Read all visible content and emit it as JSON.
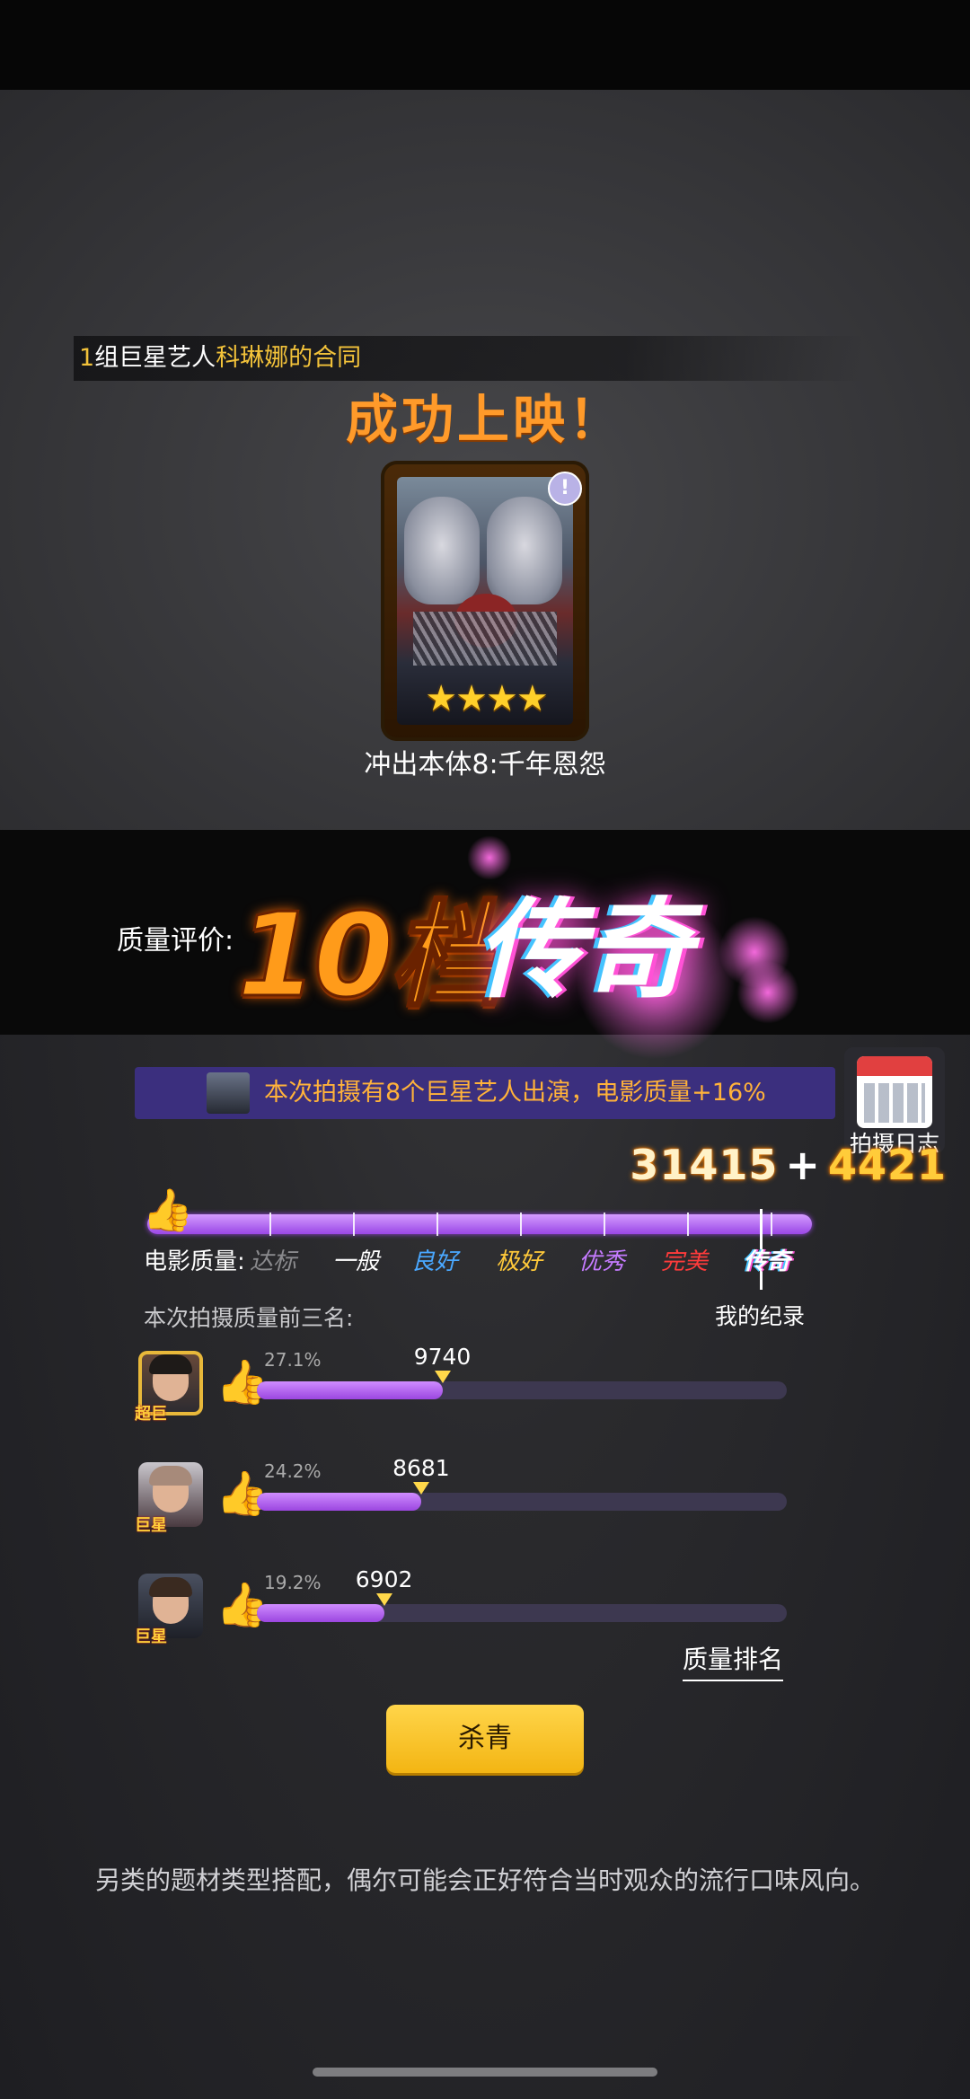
{
  "contract": {
    "count": "1",
    "text1": "组巨星艺人",
    "name": "科琳娜的合同"
  },
  "release_title": "成功上映！",
  "poster": {
    "alert": "!",
    "stars": "★★★★"
  },
  "movie_name": "冲出本体8:千年恩怨",
  "rating": {
    "label": "质量评价:",
    "level": "10档",
    "grade": "传奇"
  },
  "bonus": {
    "text": "本次拍摄有8个巨星艺人出演，电影质量+16%"
  },
  "calendar": {
    "label": "拍摄日志"
  },
  "score": {
    "base": "31415",
    "plus": "+",
    "bonus": "4421"
  },
  "quality": {
    "label": "电影质量:",
    "grades": [
      {
        "name": "达标",
        "color": "#8a8a8d"
      },
      {
        "name": "一般",
        "color": "#ffffff"
      },
      {
        "name": "良好",
        "color": "#4aa8ff"
      },
      {
        "name": "极好",
        "color": "#ffc93a"
      },
      {
        "name": "优秀",
        "color": "#c57bff"
      },
      {
        "name": "完美",
        "color": "#ff3b3b"
      },
      {
        "name": "传奇",
        "color": "#ffffff"
      }
    ],
    "my_record": "我的纪录"
  },
  "top3": {
    "label": "本次拍摄质量前三名:",
    "rows": [
      {
        "tag": "超巨",
        "pct": "27.1%",
        "value": "9740",
        "fraction": 0.35
      },
      {
        "tag": "巨星",
        "pct": "24.2%",
        "value": "8681",
        "fraction": 0.31
      },
      {
        "tag": "巨星",
        "pct": "19.2%",
        "value": "6902",
        "fraction": 0.24
      }
    ]
  },
  "rank_link": "质量排名",
  "wrap_button": "杀青",
  "tip": "另类的题材类型搭配，偶尔可能会正好符合当时观众的流行口味风向。"
}
